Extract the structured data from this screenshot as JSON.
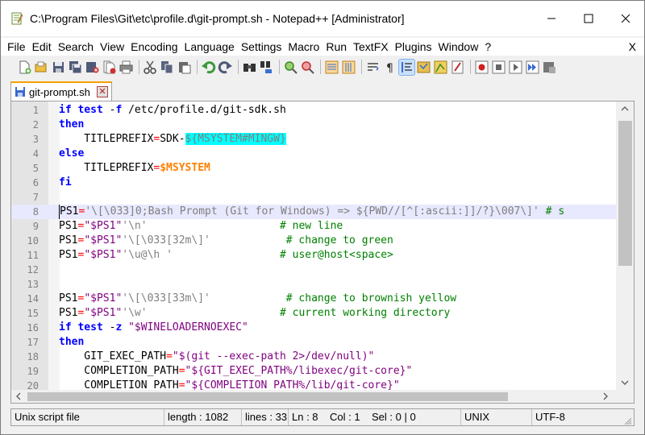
{
  "window": {
    "title": "C:\\Program Files\\Git\\etc\\profile.d\\git-prompt.sh - Notepad++ [Administrator]"
  },
  "menu": {
    "items": [
      "File",
      "Edit",
      "Search",
      "View",
      "Encoding",
      "Language",
      "Settings",
      "Macro",
      "Run",
      "TextFX",
      "Plugins",
      "Window",
      "?"
    ],
    "close_label": "X"
  },
  "toolbar": {
    "buttons": [
      "new-file-icon",
      "open-file-icon",
      "save-icon",
      "save-all-icon",
      "close-file-icon",
      "close-all-icon",
      "print-icon",
      "cut-icon",
      "copy-icon",
      "paste-icon",
      "undo-icon",
      "redo-icon",
      "find-icon",
      "replace-icon",
      "zoom-in-icon",
      "zoom-out-icon",
      "sync-vertical-icon",
      "sync-horizontal-icon",
      "word-wrap-icon",
      "show-all-chars-icon",
      "indent-guide-icon",
      "user-lang-icon",
      "doc-map-icon",
      "function-list-icon",
      "record-macro-icon",
      "stop-macro-icon",
      "play-macro-icon",
      "run-macro-multiple-icon",
      "save-macro-icon"
    ]
  },
  "tab": {
    "label": "git-prompt.sh",
    "close_symbol": "✕"
  },
  "editor": {
    "lines": [
      {
        "n": "1",
        "tokens": [
          [
            "kw",
            "if"
          ],
          [
            "id",
            " "
          ],
          [
            "kw",
            "test"
          ],
          [
            "id",
            " -"
          ],
          [
            "kw",
            "f"
          ],
          [
            "id",
            " /etc/profile.d/git-sdk.sh"
          ]
        ]
      },
      {
        "n": "2",
        "tokens": [
          [
            "kw",
            "then"
          ]
        ]
      },
      {
        "n": "3",
        "tokens": [
          [
            "id",
            "    TITLEPREFIX"
          ],
          [
            "op",
            "="
          ],
          [
            "id",
            "SDK-"
          ],
          [
            "varbg",
            "${MSYSTEM#MINGW}"
          ]
        ]
      },
      {
        "n": "4",
        "tokens": [
          [
            "kw",
            "else"
          ]
        ]
      },
      {
        "n": "5",
        "tokens": [
          [
            "id",
            "    TITLEPREFIX"
          ],
          [
            "op",
            "="
          ],
          [
            "var",
            "$MSYSTEM"
          ]
        ]
      },
      {
        "n": "6",
        "tokens": [
          [
            "kw",
            "fi"
          ]
        ]
      },
      {
        "n": "7",
        "tokens": []
      },
      {
        "n": "8",
        "current": true,
        "tokens": [
          [
            "id",
            "PS1"
          ],
          [
            "op",
            "="
          ],
          [
            "str2",
            "'\\[\\033]0;Bash Prompt (Git for Windows) => ${PWD//[^[:ascii:]]/?}\\007\\]'"
          ],
          [
            "com",
            " # s"
          ]
        ]
      },
      {
        "n": "9",
        "tokens": [
          [
            "id",
            "PS1"
          ],
          [
            "op",
            "="
          ],
          [
            "dq",
            "\"$PS1\""
          ],
          [
            "str2",
            "'\\n'"
          ],
          [
            "id",
            "                     "
          ],
          [
            "com",
            "# new line"
          ]
        ]
      },
      {
        "n": "10",
        "tokens": [
          [
            "id",
            "PS1"
          ],
          [
            "op",
            "="
          ],
          [
            "dq",
            "\"$PS1\""
          ],
          [
            "str2",
            "'\\[\\033[32m\\]'"
          ],
          [
            "id",
            "            "
          ],
          [
            "com",
            "# change to green"
          ]
        ]
      },
      {
        "n": "11",
        "tokens": [
          [
            "id",
            "PS1"
          ],
          [
            "op",
            "="
          ],
          [
            "dq",
            "\"$PS1\""
          ],
          [
            "str2",
            "'\\u@\\h '"
          ],
          [
            "id",
            "                 "
          ],
          [
            "com",
            "# user@host<space>"
          ]
        ]
      },
      {
        "n": "12",
        "tokens": []
      },
      {
        "n": "13",
        "tokens": []
      },
      {
        "n": "14",
        "tokens": [
          [
            "id",
            "PS1"
          ],
          [
            "op",
            "="
          ],
          [
            "dq",
            "\"$PS1\""
          ],
          [
            "str2",
            "'\\[\\033[33m\\]'"
          ],
          [
            "id",
            "            "
          ],
          [
            "com",
            "# change to brownish yellow"
          ]
        ]
      },
      {
        "n": "15",
        "tokens": [
          [
            "id",
            "PS1"
          ],
          [
            "op",
            "="
          ],
          [
            "dq",
            "\"$PS1\""
          ],
          [
            "str2",
            "'\\w'"
          ],
          [
            "id",
            "                     "
          ],
          [
            "com",
            "# current working directory"
          ]
        ]
      },
      {
        "n": "16",
        "tokens": [
          [
            "kw",
            "if"
          ],
          [
            "id",
            " "
          ],
          [
            "kw",
            "test"
          ],
          [
            "id",
            " -"
          ],
          [
            "kw",
            "z"
          ],
          [
            "id",
            " "
          ],
          [
            "dq",
            "\"$WINELOADERNOEXEC\""
          ]
        ]
      },
      {
        "n": "17",
        "tokens": [
          [
            "kw",
            "then"
          ]
        ]
      },
      {
        "n": "18",
        "tokens": [
          [
            "id",
            "    GIT_EXEC_PATH"
          ],
          [
            "op",
            "="
          ],
          [
            "dq",
            "\"$(git --exec-path 2>/dev/null)\""
          ]
        ]
      },
      {
        "n": "19",
        "tokens": [
          [
            "id",
            "    COMPLETION_PATH"
          ],
          [
            "op",
            "="
          ],
          [
            "dq",
            "\"${GIT_EXEC_PATH%/libexec/git-core}\""
          ]
        ]
      },
      {
        "n": "20",
        "tokens": [
          [
            "id",
            "    COMPLETION_PATH"
          ],
          [
            "op",
            "="
          ],
          [
            "dq",
            "\"${COMPLETION_PATH%/lib/git-core}\""
          ]
        ]
      }
    ]
  },
  "status": {
    "file_type": "Unix script file",
    "length": "length : 1082",
    "lines": "lines : 33",
    "position": "Ln : 8    Col : 1    Sel : 0 | 0",
    "eol": "UNIX",
    "encoding": "UTF-8"
  }
}
